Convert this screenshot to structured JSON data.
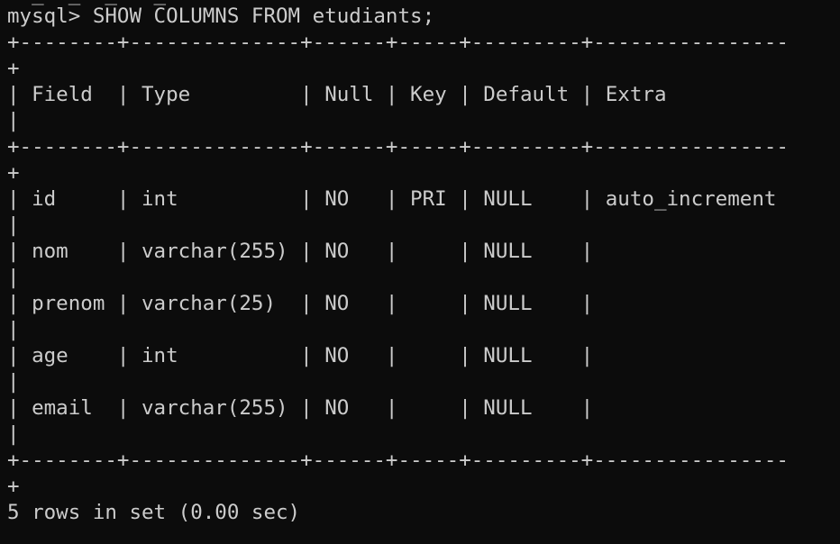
{
  "terminal": {
    "background_color": "#0c0c0c",
    "text_color": "#cccccc",
    "lines": [
      "mysql> SHOW COLUMNS FROM etudiants;",
      "+--------+--------------+------+-----+---------+----------------",
      "+",
      "| Field  | Type         | Null | Key | Default | Extra",
      "|",
      "+--------+--------------+------+-----+---------+----------------",
      "+",
      "| id     | int          | NO   | PRI | NULL    | auto_increment",
      "|",
      "| nom    | varchar(255) | NO   |     | NULL    |",
      "|",
      "| prenom | varchar(25)  | NO   |     | NULL    |",
      "|",
      "| age    | int          | NO   |     | NULL    |",
      "|",
      "| email  | varchar(255) | NO   |     | NULL    |",
      "|",
      "+--------+--------------+------+-----+---------+----------------",
      "+",
      "5 rows in set (0.00 sec)"
    ]
  }
}
